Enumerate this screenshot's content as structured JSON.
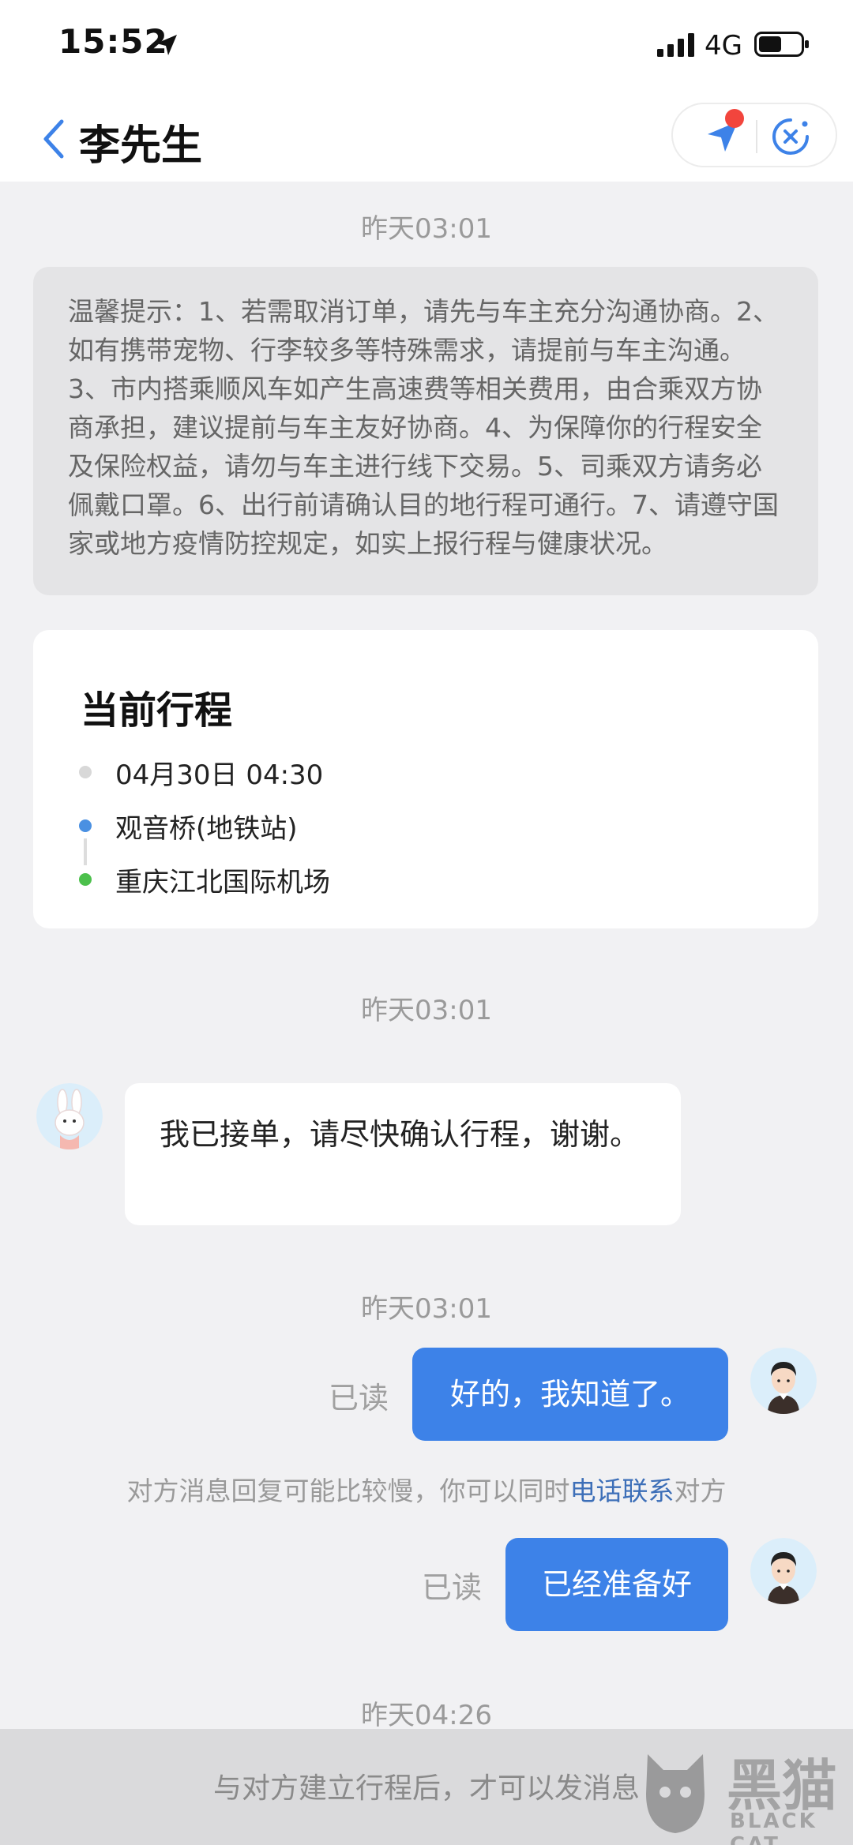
{
  "status_bar": {
    "time": "15:52",
    "network": "4G"
  },
  "header": {
    "title": "李先生"
  },
  "timestamps": [
    "昨天03:01",
    "昨天03:01",
    "昨天03:01",
    "昨天04:26"
  ],
  "tips": {
    "text": "温馨提示：1、若需取消订单，请先与车主充分沟通协商。2、如有携带宠物、行李较多等特殊需求，请提前与车主沟通。3、市内搭乘顺风车如产生高速费等相关费用，由合乘双方协商承担，建议提前与车主友好协商。4、为保障你的行程安全及保险权益，请勿与车主进行线下交易。5、司乘双方请务必佩戴口罩。6、出行前请确认目的地行程可通行。7、请遵守国家或地方疫情防控规定，如实上报行程与健康状况。"
  },
  "trip": {
    "title": "当前行程",
    "time": "04月30日 04:30",
    "origin": "观音桥(地铁站)",
    "destination": "重庆江北国际机场",
    "colors": {
      "time_dot": "#d8d8d8",
      "origin_dot": "#4a90e2",
      "destination_dot": "#4cc04c"
    }
  },
  "messages": {
    "incoming": "我已接单，请尽快确认行程，谢谢。",
    "outgoing_1": "好的，我知道了。",
    "outgoing_2": "已经准备好",
    "read_label": "已读"
  },
  "notice": {
    "before": "对方消息回复可能比较慢，你可以同时",
    "link": "电话联系",
    "after": "对方"
  },
  "bottom": {
    "hint": "与对方建立行程后，才可以发消息"
  },
  "watermark": {
    "main": "黑猫",
    "sub": "BLACK CAT"
  },
  "colors": {
    "accent": "#3d82e8",
    "link": "#3d6fb8",
    "alert_dot": "#f2453d"
  }
}
